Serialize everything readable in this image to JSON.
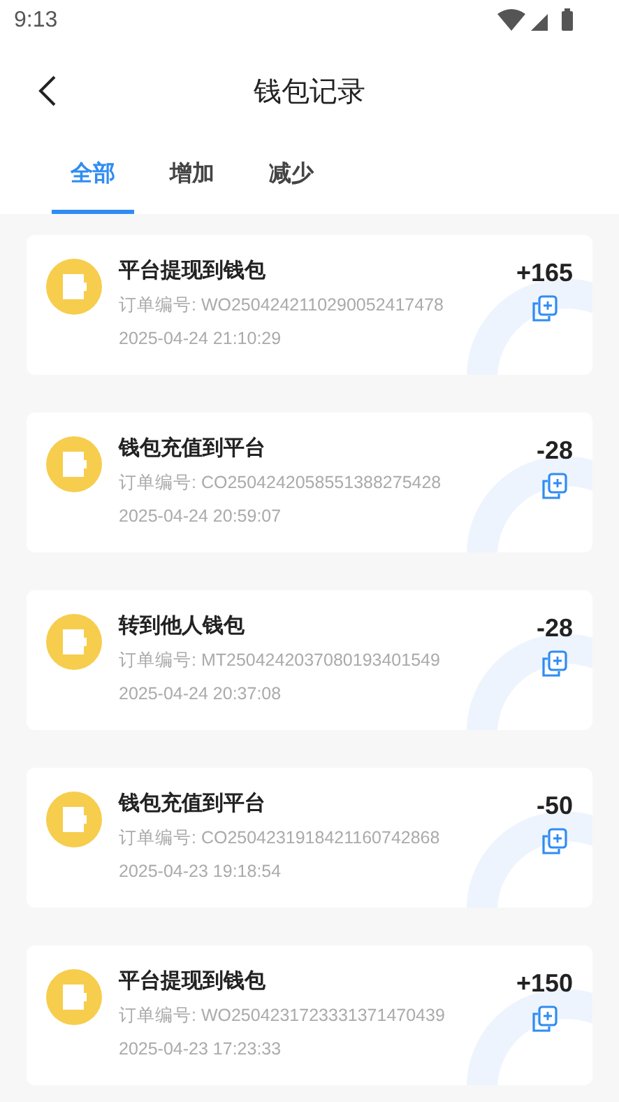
{
  "status_bar": {
    "time": "9:13"
  },
  "header": {
    "title": "钱包记录"
  },
  "tabs": [
    {
      "label": "全部",
      "selected": true
    },
    {
      "label": "增加",
      "selected": false
    },
    {
      "label": "减少",
      "selected": false
    }
  ],
  "records": [
    {
      "title": "平台提现到钱包",
      "amount": "+165",
      "order": "订单编号: WO2504242110290052417478",
      "time": "2025-04-24 21:10:29"
    },
    {
      "title": "钱包充值到平台",
      "amount": "-28",
      "order": "订单编号: CO2504242058551388275428",
      "time": "2025-04-24 20:59:07"
    },
    {
      "title": "转到他人钱包",
      "amount": "-28",
      "order": "订单编号: MT2504242037080193401549",
      "time": "2025-04-24 20:37:08"
    },
    {
      "title": "钱包充值到平台",
      "amount": "-50",
      "order": "订单编号: CO2504231918421160742868",
      "time": "2025-04-23 19:18:54"
    },
    {
      "title": "平台提现到钱包",
      "amount": "+150",
      "order": "订单编号: WO2504231723331371470439",
      "time": "2025-04-23 17:23:33"
    }
  ]
}
